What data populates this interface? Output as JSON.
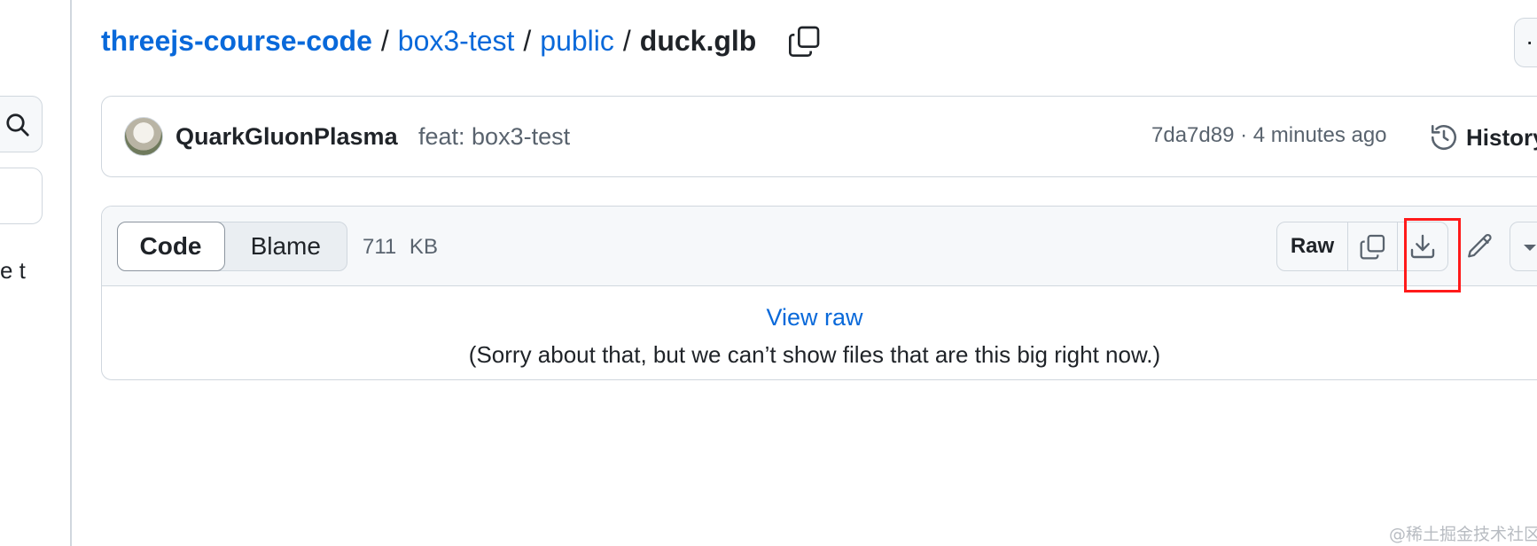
{
  "sidebar": {
    "partial_text": "e t"
  },
  "breadcrumb": {
    "repo": "threejs-course-code",
    "folder1": "box3-test",
    "folder2": "public",
    "file": "duck.glb",
    "separator": "/"
  },
  "more_menu": {
    "glyph": "·"
  },
  "commit": {
    "author": "QuarkGluonPlasma",
    "message": "feat: box3-test",
    "meta": "7da7d89 · 4 minutes ago",
    "history_label": "History"
  },
  "file_header": {
    "tabs": [
      "Code",
      "Blame"
    ],
    "size": "711  KB",
    "raw_label": "Raw",
    "actions": [
      "copy-raw",
      "download",
      "edit",
      "more"
    ]
  },
  "file_body": {
    "view_raw": "View raw",
    "notice": "(Sorry about that, but we can’t show files that are this big right now.)"
  },
  "annotation": {
    "highlight_color": "#ff1a1a",
    "target": "download"
  },
  "watermark": "@稀土掘金技术社区",
  "colors": {
    "link": "#0969da",
    "border": "#d0d7de",
    "muted": "#59636e",
    "text": "#1f2328"
  }
}
